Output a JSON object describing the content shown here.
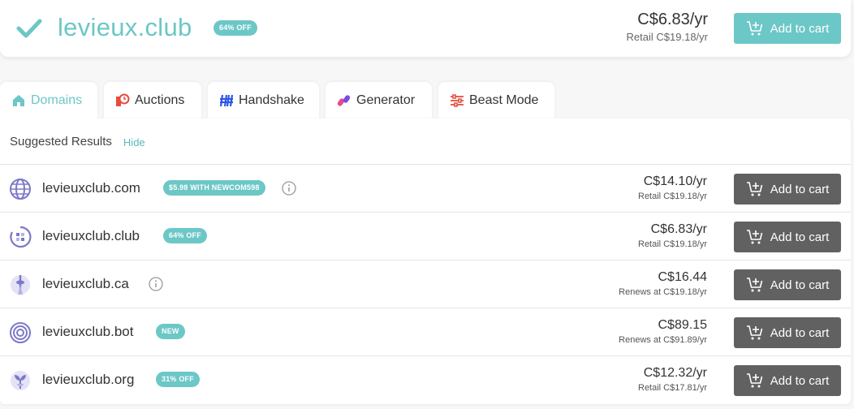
{
  "hero": {
    "domain": "levieux.club",
    "badge": "64% OFF",
    "price": "C$6.83/yr",
    "retail": "Retail C$19.18/yr",
    "cart_label": "Add to cart",
    "accent": "#6cc7c7"
  },
  "tabs": [
    {
      "label": "Domains",
      "icon": "home-icon",
      "active": true
    },
    {
      "label": "Auctions",
      "icon": "auction-clock-icon"
    },
    {
      "label": "Handshake",
      "icon": "handshake-icon"
    },
    {
      "label": "Generator",
      "icon": "generator-icon"
    },
    {
      "label": "Beast Mode",
      "icon": "sliders-icon"
    }
  ],
  "suggested": {
    "label": "Suggested Results",
    "hide_label": "Hide"
  },
  "results": [
    {
      "name": "levieuxclub.com",
      "badge": "$5.98 WITH NEWCOM598",
      "info": true,
      "price": "C$14.10/yr",
      "retail": "Retail C$19.18/yr",
      "cart_label": "Add to cart",
      "icon": "globe-icon"
    },
    {
      "name": "levieuxclub.club",
      "badge": "64% OFF",
      "info": false,
      "price": "C$6.83/yr",
      "retail": "Retail C$19.18/yr",
      "cart_label": "Add to cart",
      "icon": "club-tld-icon"
    },
    {
      "name": "levieuxclub.ca",
      "badge": "",
      "info": true,
      "price": "C$16.44",
      "retail": "Renews at C$19.18/yr",
      "cart_label": "Add to cart",
      "icon": "cn-tower-icon"
    },
    {
      "name": "levieuxclub.bot",
      "badge": "NEW",
      "info": false,
      "price": "C$89.15",
      "retail": "Renews at C$91.89/yr",
      "cart_label": "Add to cart",
      "icon": "target-icon"
    },
    {
      "name": "levieuxclub.org",
      "badge": "31% OFF",
      "info": false,
      "price": "C$12.32/yr",
      "retail": "Retail C$17.81/yr",
      "cart_label": "Add to cart",
      "icon": "sprout-icon"
    }
  ]
}
